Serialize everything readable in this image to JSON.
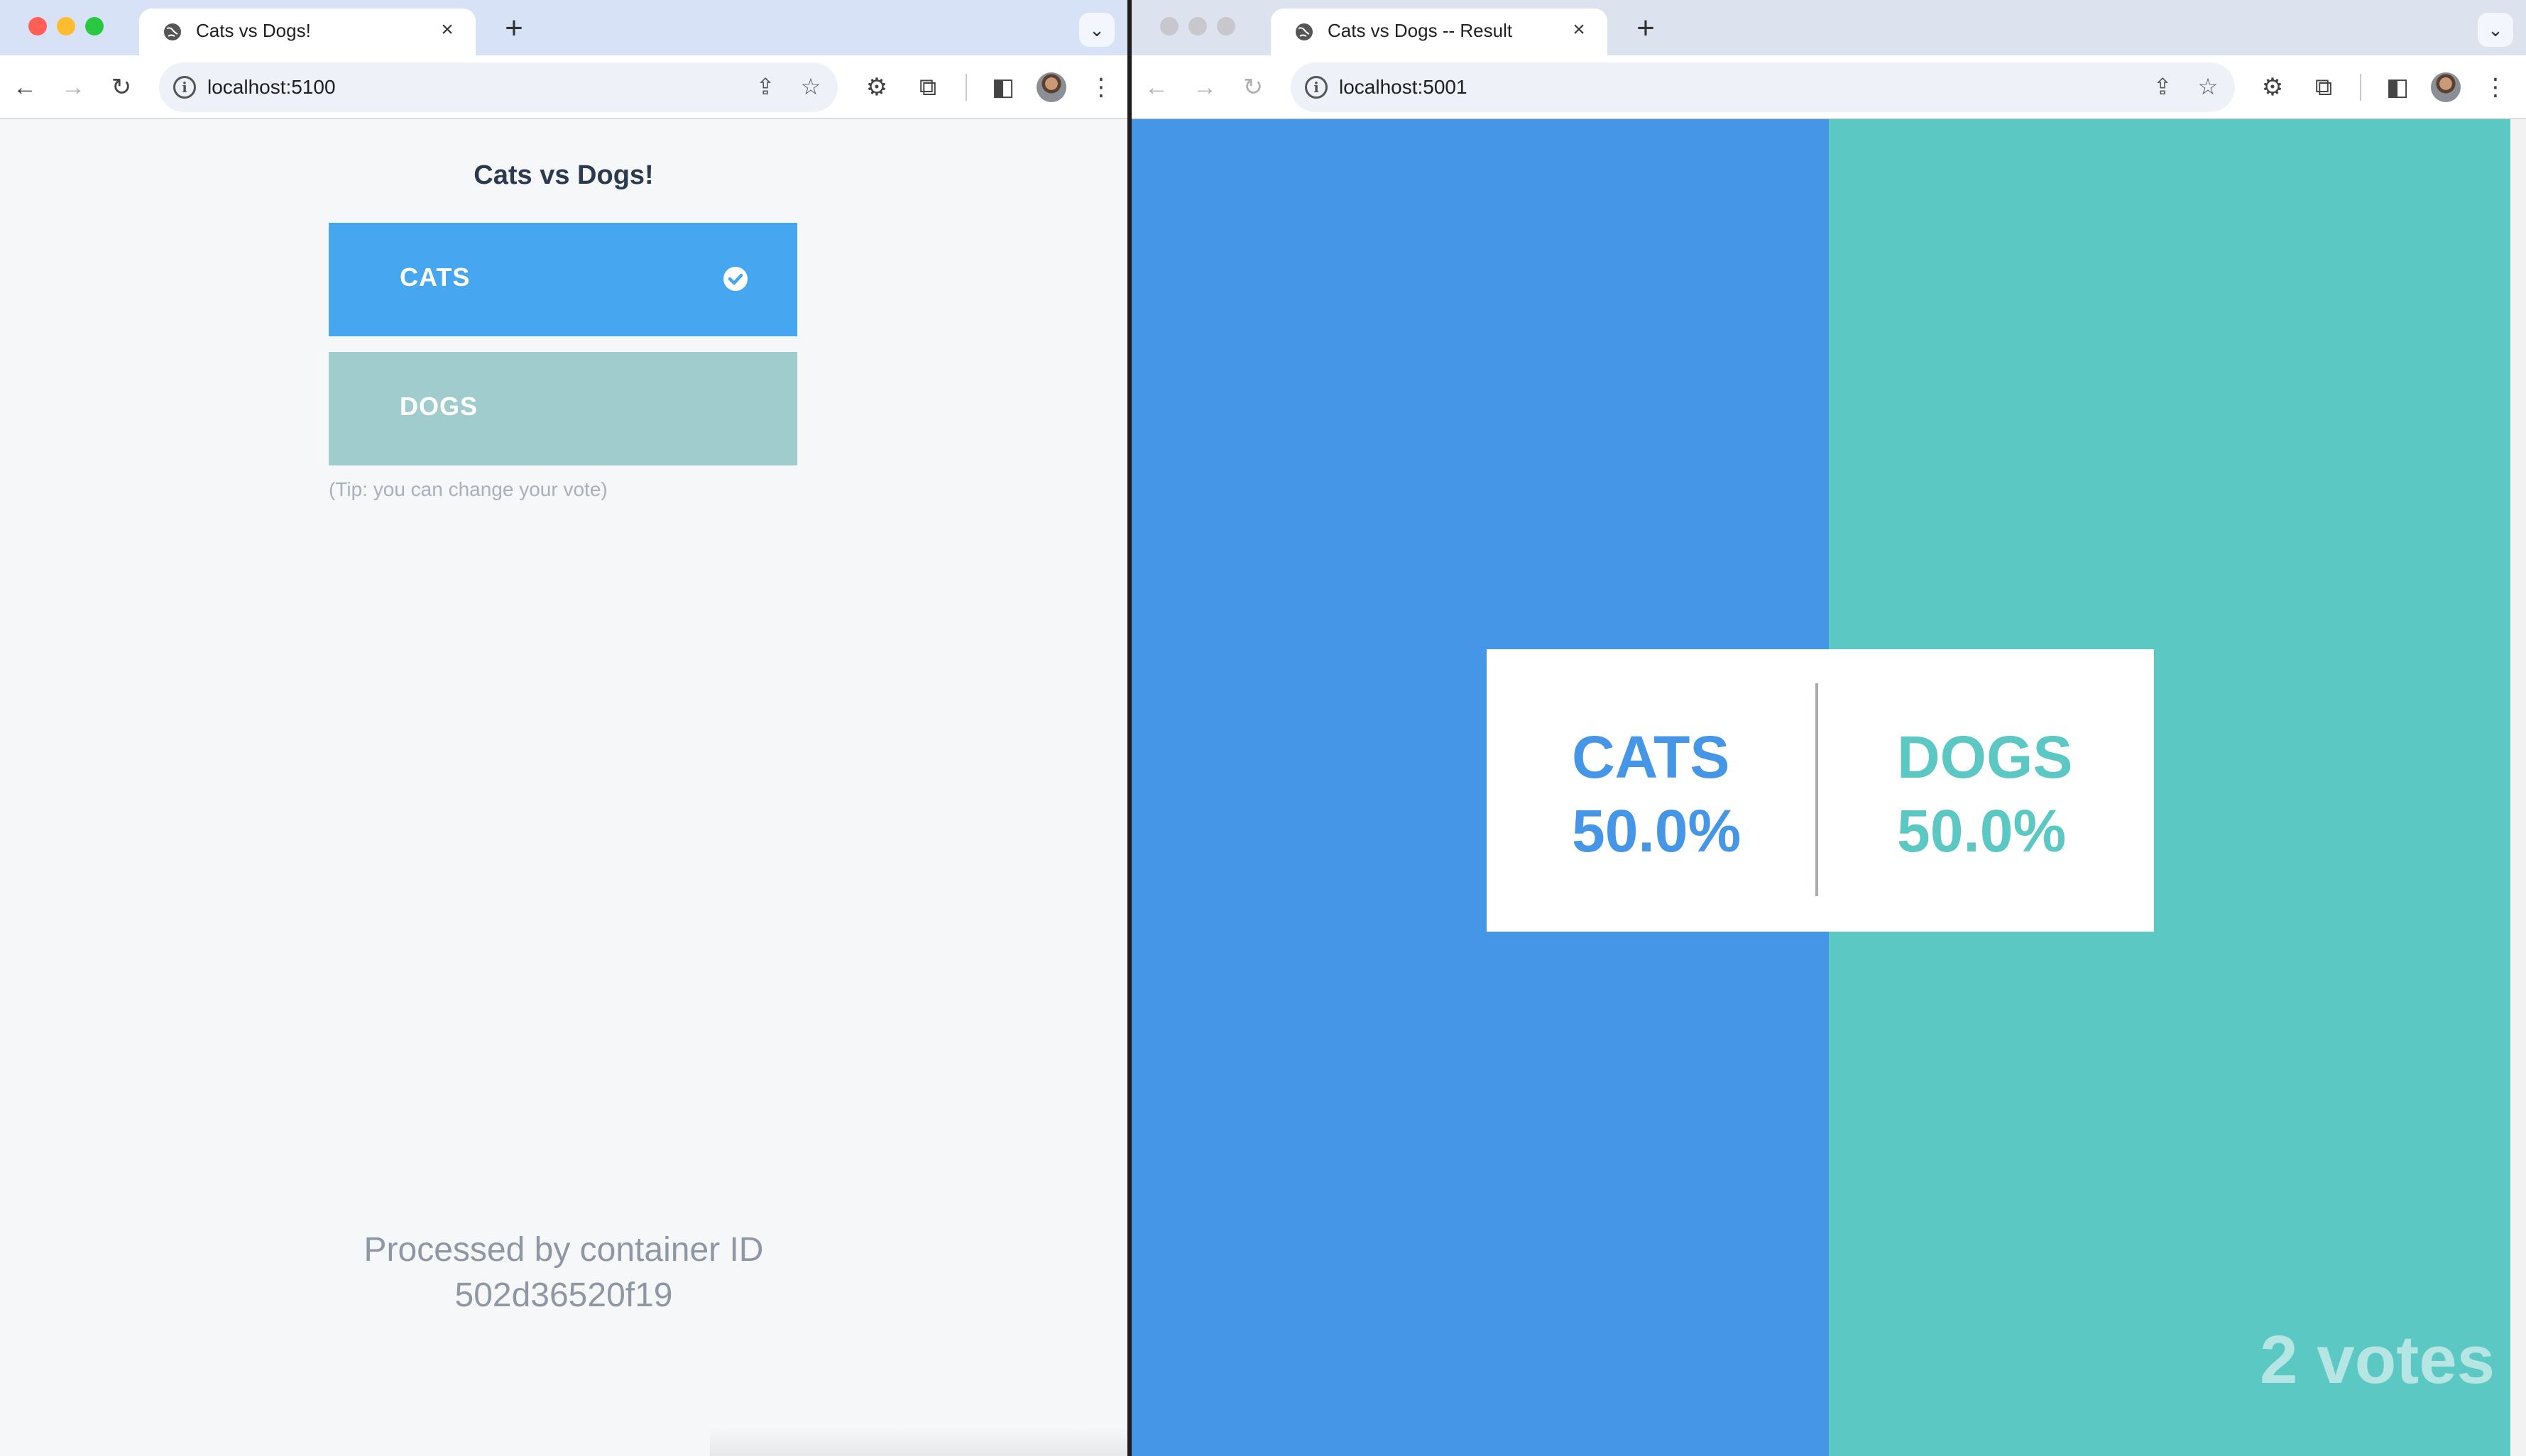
{
  "colors": {
    "cats_blue": "#4696e8",
    "dogs_teal": "#5cc8c4",
    "vote_cats": "#46a6f0",
    "vote_dogs": "#a1cccd",
    "tl_red": "#ff5f57",
    "tl_yellow": "#febc2e",
    "tl_green": "#28c840",
    "tl_inactive": "#c8c8cc"
  },
  "left_window": {
    "tab": {
      "title": "Cats vs Dogs!",
      "globe_icon": "globe-icon",
      "close_icon": "close-icon"
    },
    "url": "localhost:5100",
    "page": {
      "title": "Cats vs Dogs!",
      "options": [
        {
          "label": "CATS",
          "selected": true
        },
        {
          "label": "DOGS",
          "selected": false
        }
      ],
      "tip": "(Tip: you can change your vote)",
      "container_line1": "Processed by container ID",
      "container_id": "502d36520f19"
    }
  },
  "right_window": {
    "tab": {
      "title": "Cats vs Dogs -- Result",
      "globe_icon": "globe-icon",
      "close_icon": "close-icon"
    },
    "url": "localhost:5001",
    "page": {
      "cats_label": "CATS",
      "cats_percent": "50.0%",
      "dogs_label": "DOGS",
      "dogs_percent": "50.0%",
      "votes": "2 votes",
      "cats_share": 0.5
    }
  }
}
